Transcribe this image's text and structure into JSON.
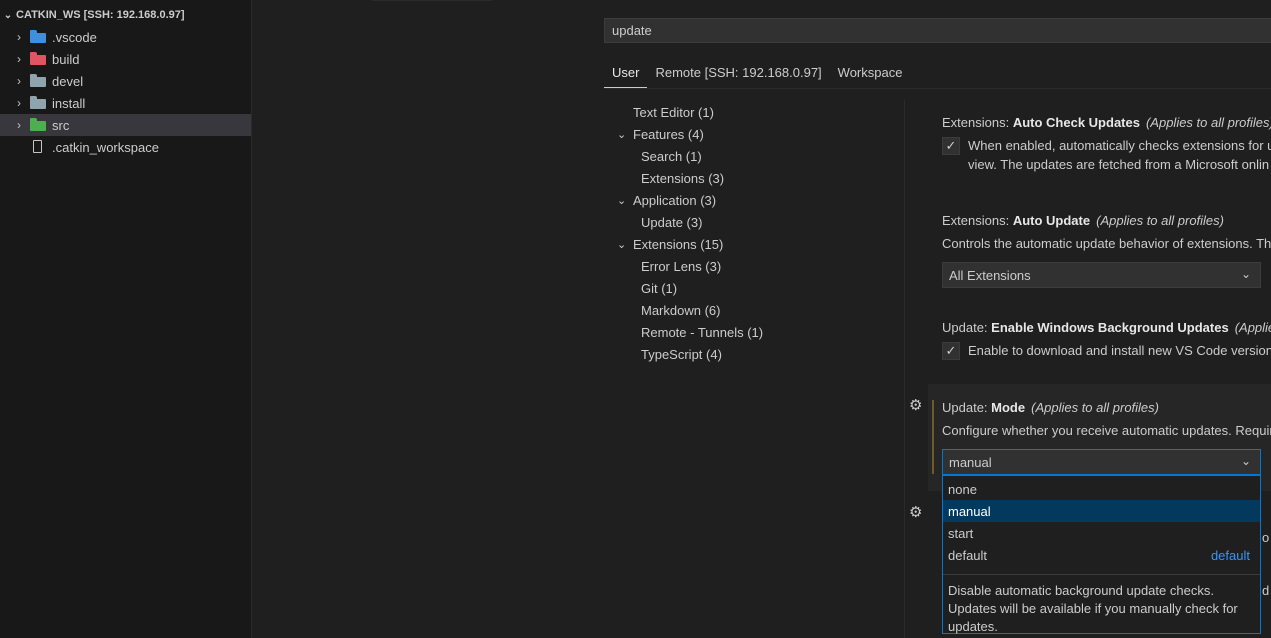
{
  "explorer": {
    "workspace_title": "CATKIN_WS [SSH: 192.168.0.97]",
    "items": [
      {
        "label": ".vscode",
        "icon": "vscode-folder-icon",
        "color": "#3d8fe0",
        "badge": "⤬"
      },
      {
        "label": "build",
        "icon": "build-folder-icon",
        "color": "#e05561",
        "badge": "▪"
      },
      {
        "label": "devel",
        "icon": "folder-icon",
        "color": "#90a4ae",
        "badge": ""
      },
      {
        "label": "install",
        "icon": "folder-icon",
        "color": "#90a4ae",
        "badge": ""
      },
      {
        "label": "src",
        "icon": "src-folder-icon",
        "color": "#4caf50",
        "badge": "</>"
      },
      {
        "label": ".catkin_workspace",
        "icon": "file-icon",
        "color": "#c5c5c5",
        "badge": ""
      }
    ]
  },
  "settings": {
    "search_value": "update",
    "scope_tabs": [
      "User",
      "Remote [SSH: 192.168.0.97]",
      "Workspace"
    ],
    "toc": [
      {
        "label": "Text Editor (1)",
        "level": 0,
        "expandable": false
      },
      {
        "label": "Features (4)",
        "level": 0,
        "expandable": true
      },
      {
        "label": "Search (1)",
        "level": 1,
        "expandable": false
      },
      {
        "label": "Extensions (3)",
        "level": 1,
        "expandable": false
      },
      {
        "label": "Application (3)",
        "level": 0,
        "expandable": true
      },
      {
        "label": "Update (3)",
        "level": 1,
        "expandable": false
      },
      {
        "label": "Extensions (15)",
        "level": 0,
        "expandable": true
      },
      {
        "label": "Error Lens (3)",
        "level": 1,
        "expandable": false
      },
      {
        "label": "Git (1)",
        "level": 1,
        "expandable": false
      },
      {
        "label": "Markdown (6)",
        "level": 1,
        "expandable": false
      },
      {
        "label": "Remote - Tunnels (1)",
        "level": 1,
        "expandable": false
      },
      {
        "label": "TypeScript (4)",
        "level": 1,
        "expandable": false
      }
    ],
    "items": {
      "auto_check": {
        "category": "Extensions: ",
        "name": "Auto Check Updates",
        "scope": "(Applies to all profiles)",
        "desc_line1": "When enabled, automatically checks extensions for u",
        "desc_line2": "view. The updates are fetched from a Microsoft onlin",
        "checked": "✓"
      },
      "auto_update": {
        "category": "Extensions: ",
        "name": "Auto Update",
        "scope": "(Applies to all profiles)",
        "desc": "Controls the automatic update behavior of extensions. Th",
        "value": "All Extensions"
      },
      "windows_bg": {
        "category": "Update: ",
        "name": "Enable Windows Background Updates",
        "scope": "(Applies",
        "desc": "Enable to download and install new VS Code versions",
        "checked": "✓"
      },
      "mode": {
        "category": "Update: ",
        "name": "Mode",
        "scope": "(Applies to all profiles)",
        "desc": "Configure whether you receive automatic updates. Requir",
        "value": "manual",
        "options": [
          {
            "label": "none",
            "selected": false,
            "tag": ""
          },
          {
            "label": "manual",
            "selected": true,
            "tag": ""
          },
          {
            "label": "start",
            "selected": false,
            "tag": ""
          },
          {
            "label": "default",
            "selected": false,
            "tag": "default"
          }
        ],
        "option_desc": "Disable automatic background update checks. Updates will be available if you manually check for updates."
      }
    },
    "trailing_fragment_1": "o",
    "trailing_fragment_2": "d"
  },
  "colors": {
    "accent": "#0078d4",
    "selection": "#04395e",
    "link": "#3794ff"
  }
}
